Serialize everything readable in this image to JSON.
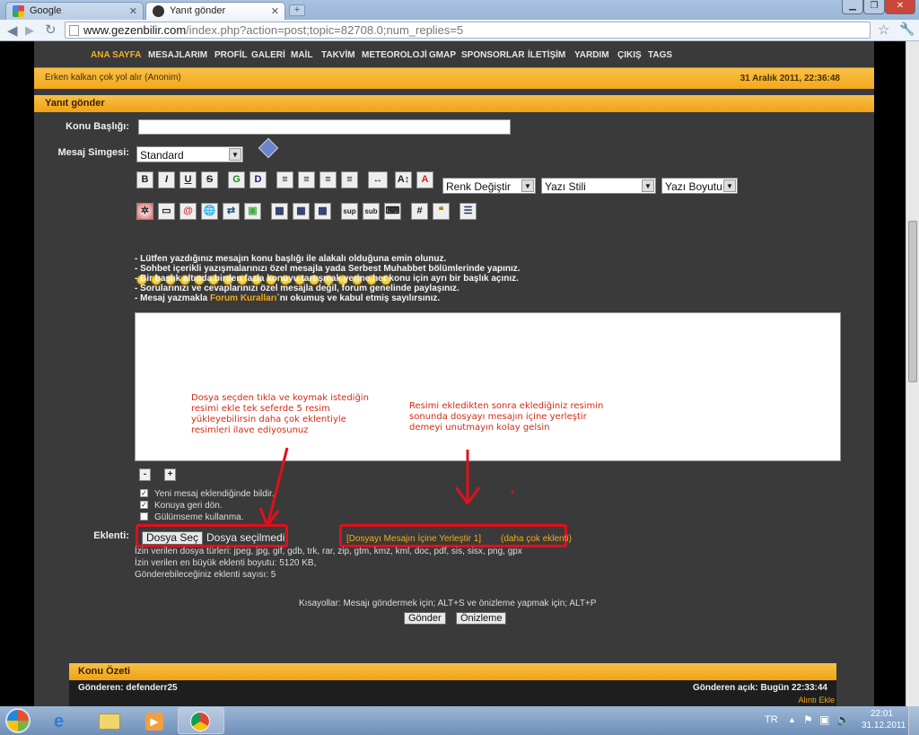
{
  "browser": {
    "tabs": [
      {
        "title": "Google"
      },
      {
        "title": "Yanıt gönder"
      }
    ],
    "url_host": "www.gezenbilir.com",
    "url_path": "/index.php?action=post;topic=82708.0;num_replies=5"
  },
  "menu": [
    "ANA SAYFA",
    "MESAJLARIM",
    "PROFİL",
    "GALERİ",
    "MAİL",
    "TAKVİM",
    "METEOROLOJİ",
    "GMAP",
    "SPONSORLAR",
    "İLETİŞİM",
    "YARDIM",
    "ÇIKIŞ",
    "TAGS"
  ],
  "quote": "Erken kalkan çok yol alır (Anonim)",
  "datetime": "31 Aralık 2011, 22:36:48",
  "post_header": "Yanıt gönder",
  "subject_label": "Konu Başlığı:",
  "icon_label": "Mesaj Simgesi:",
  "icon_value": "Standard",
  "format_buttons": [
    "B",
    "I",
    "U",
    "S"
  ],
  "color_select": "Renk Değiştir",
  "style_select": "Yazı Stili",
  "size_select": "Yazı Boyutu",
  "rules": [
    "- Lütfen yazdığınız mesajın konu başlığı ile alakalı olduğuna emin olunuz.",
    "- Sohbet içerikli yazışmalarınızı özel mesajla yada Serbest Muhabbet bölümlerinde yapınız.",
    "- Bir başlık altında birden fazla konuyu tartışmak yerine her konu için ayrı bir başlık açınız.",
    "- Sorularınızı ve cevaplarınızı özel mesajla değil, forum genelinde paylaşınız."
  ],
  "rule5_before": "- Mesaj yazmakla ",
  "rule5_link": "Forum Kuralları",
  "rule5_after": "`nı okumuş ve kabul etmiş sayılırsınız.",
  "annotations": {
    "left": [
      "Dosya seçden tıkla ve koymak istediğin",
      "resimi ekle tek seferde 5 resim",
      "yükleyebilirsin daha çok eklentiyle",
      "resimleri ilave ediyosunuz"
    ],
    "right": [
      "Resimi ekledikten sonra eklediğiniz resimin",
      "sonunda dosyayı mesajın içine yerleştir",
      "demeyi unutmayın kolay gelsin"
    ]
  },
  "resize": {
    "minus": "-",
    "plus": "+"
  },
  "options": [
    "Yeni mesaj eklendiğinde bildir.",
    "Konuya geri dön.",
    "Gülümseme kullanma."
  ],
  "attach_label": "Eklenti:",
  "file_button": "Dosya Seç",
  "file_status": "Dosya seçilmedi",
  "insert_link": "[Dosyayı Mesajın İçine Yerleştir 1]",
  "more_link": "(daha çok eklenti)",
  "allowed_types": "İzin verilen dosya türleri: jpeg, jpg, gif, gdb, trk, rar, zip, gtm, kmz, kml, doc, pdf, sis, sisx, png, gpx",
  "max_size": "İzin verilen en büyük eklenti boyutu: 5120 KB,",
  "max_count": "Gönderebileceğiniz eklenti sayısı: 5",
  "shortcuts": "Kısayollar: Mesajı göndermek için; ALT+S ve önizleme yapmak için; ALT+P",
  "submit": "Gönder",
  "preview": "Önizleme",
  "summary_header": "Konu Özeti",
  "sender": "Gönderen: defenderr25",
  "sent_at": "Gönderen açık: Bugün 22:33:44",
  "quote_link": "Alıntı Ekle",
  "taskbar": {
    "lang": "TR",
    "time": "22:01",
    "date": "31.12.2011"
  }
}
